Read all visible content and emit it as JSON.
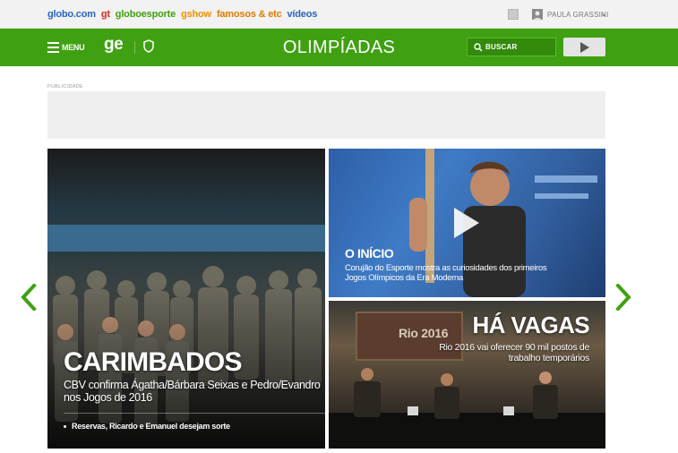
{
  "topbar": {
    "links": [
      {
        "label": "globo.com",
        "color": "#2a63c4"
      },
      {
        "label": "gt",
        "color": "#d62c1a"
      },
      {
        "label": "globoesporte",
        "color": "#3fa111"
      },
      {
        "label": "gshow",
        "color": "#f28c00"
      },
      {
        "label": "famosos & etc",
        "color": "#e07a00"
      },
      {
        "label": "vídeos",
        "color": "#2a63c4"
      }
    ],
    "user_name": "PAULA GRASSINI",
    "user_chevron": "⌄"
  },
  "header": {
    "menu_label": "MENU",
    "logo": "ge",
    "section_title": "OLIMPÍADAS",
    "search_label": "BUSCAR",
    "brand_color": "#3fa111"
  },
  "ad": {
    "label": "PUBLICIDADE"
  },
  "carousel": {
    "prev_icon": "chevron-left-icon",
    "next_icon": "chevron-right-icon",
    "arrow_color": "#3fa111",
    "main": {
      "title": "CARIMBADOS",
      "subtitle": "CBV confirma Ágatha/Bárbara Seixas e Pedro/Evandro nos Jogos de 2016",
      "related": "Reservas, Ricardo e Emanuel desejam sorte"
    },
    "top_right": {
      "title": "O INÍCIO",
      "subtitle": "Corujão do Esporte mostra as curiosidades dos primeiros Jogos Olímpicos da Era Moderna"
    },
    "bottom_right": {
      "title": "HÁ VAGAS",
      "subtitle": "Rio 2016 vai oferecer 90 mil postos de trabalho temporários",
      "backdrop_text": "Rio 2016"
    }
  }
}
